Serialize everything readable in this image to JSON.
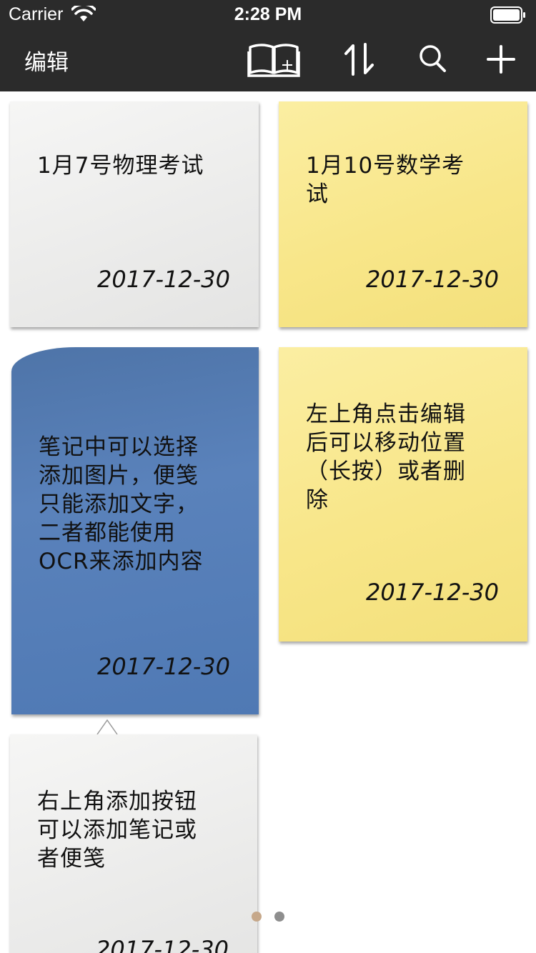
{
  "status_bar": {
    "carrier": "Carrier",
    "time": "2:28 PM"
  },
  "nav": {
    "edit_label": "编辑",
    "icons": [
      "notebook-add-icon",
      "sort-icon",
      "search-icon",
      "plus-icon"
    ]
  },
  "notes": [
    {
      "color": "white",
      "text": "1月7号物理考试",
      "date": "2017-12-30"
    },
    {
      "color": "yellow",
      "text": "1月10号数学考试",
      "date": "2017-12-30"
    },
    {
      "color": "blue",
      "text": "笔记中可以选择添加图片，便笺只能添加文字，二者都能使用OCR来添加内容",
      "date": "2017-12-30"
    },
    {
      "color": "yellow",
      "text": "左上角点击编辑后可以移动位置（长按）或者删除",
      "date": "2017-12-30"
    },
    {
      "color": "white",
      "text": "右上角添加按钮可以添加笔记或者便笺",
      "date": "2017-12-30"
    }
  ],
  "pager": {
    "pages": 2,
    "current_page": 1,
    "active_color": "#c6a88a",
    "inactive_color": "#8e8e8e"
  }
}
